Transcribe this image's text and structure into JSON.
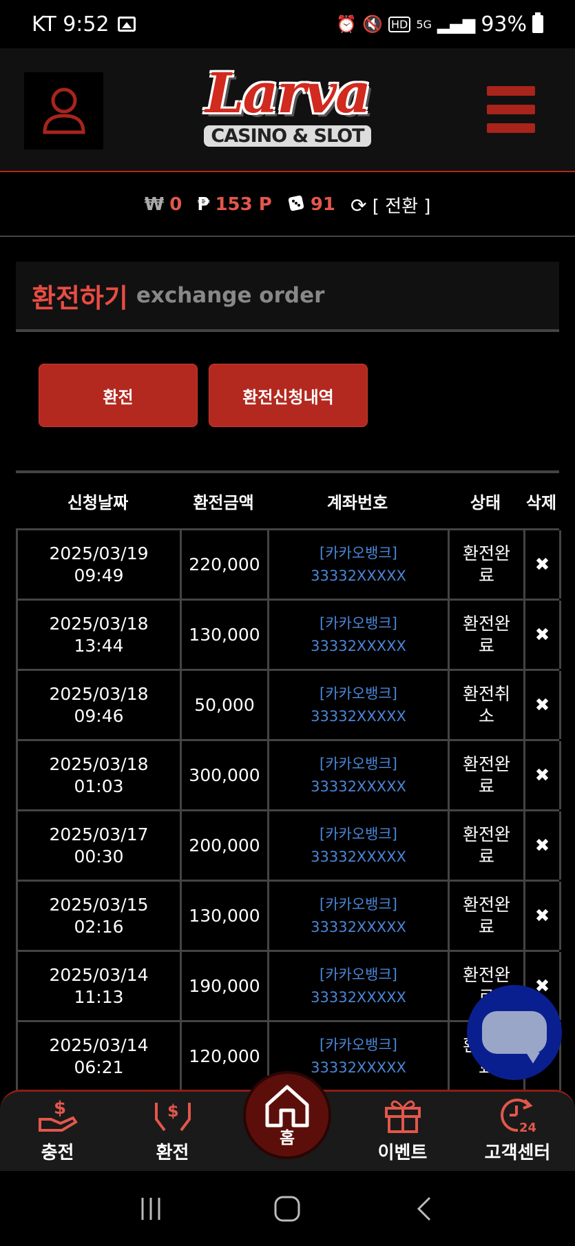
{
  "status_bar": {
    "carrier_time": "KT 9:52",
    "battery": "93%"
  },
  "header": {
    "logo_main": "Larva",
    "logo_sub": "CASINO & SLOT"
  },
  "balance": {
    "cash_symbol": "₩",
    "cash": "0",
    "point_symbol": "₱",
    "points": "153 P",
    "chips": "91",
    "swap_label": "[ 전환 ]"
  },
  "panel": {
    "title": "환전하기",
    "subtitle": "exchange order"
  },
  "buttons": {
    "exchange": "환전",
    "history": "환전신청내역"
  },
  "table": {
    "columns": [
      "신청날짜",
      "환전금액",
      "계좌번호",
      "상태",
      "삭제"
    ],
    "rows": [
      {
        "date": "2025/03/19",
        "time": "09:49",
        "amount": "220,000",
        "bank": "[카카오뱅크]",
        "account": "33332XXXXX",
        "status": "환전완료",
        "delete": "✖"
      },
      {
        "date": "2025/03/18",
        "time": "13:44",
        "amount": "130,000",
        "bank": "[카카오뱅크]",
        "account": "33332XXXXX",
        "status": "환전완료",
        "delete": "✖"
      },
      {
        "date": "2025/03/18",
        "time": "09:46",
        "amount": "50,000",
        "bank": "[카카오뱅크]",
        "account": "33332XXXXX",
        "status": "환전취소",
        "delete": "✖"
      },
      {
        "date": "2025/03/18",
        "time": "01:03",
        "amount": "300,000",
        "bank": "[카카오뱅크]",
        "account": "33332XXXXX",
        "status": "환전완료",
        "delete": "✖"
      },
      {
        "date": "2025/03/17",
        "time": "00:30",
        "amount": "200,000",
        "bank": "[카카오뱅크]",
        "account": "33332XXXXX",
        "status": "환전완료",
        "delete": "✖"
      },
      {
        "date": "2025/03/15",
        "time": "02:16",
        "amount": "130,000",
        "bank": "[카카오뱅크]",
        "account": "33332XXXXX",
        "status": "환전완료",
        "delete": "✖"
      },
      {
        "date": "2025/03/14",
        "time": "11:13",
        "amount": "190,000",
        "bank": "[카카오뱅크]",
        "account": "33332XXXXX",
        "status": "환전완료",
        "delete": "✖"
      },
      {
        "date": "2025/03/14",
        "time": "06:21",
        "amount": "120,000",
        "bank": "[카카오뱅크]",
        "account": "33332XXXXX",
        "status": "환전완료",
        "delete": "✖"
      }
    ]
  },
  "bottom_nav": {
    "deposit": "충전",
    "exchange": "환전",
    "home": "홈",
    "event": "이벤트",
    "support": "고객센터"
  },
  "colors": {
    "accent": "#b3291f",
    "link": "#4a86d8",
    "chat": "#0a1f8f"
  }
}
